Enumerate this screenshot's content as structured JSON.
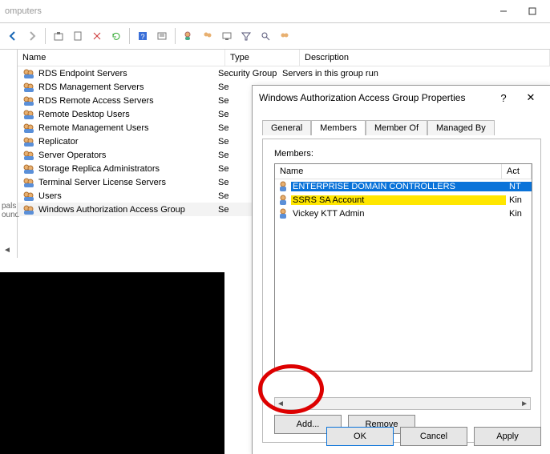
{
  "main_window": {
    "title_fragment": "omputers",
    "toolbar_hints": [
      "back",
      "forward",
      "up",
      "paste",
      "tree",
      "refresh",
      "help",
      "properties",
      "add-user-icon",
      "add-group-icon",
      "find-icon",
      "filter-icon",
      "actions-icon",
      "group-icon"
    ]
  },
  "left_strip": {
    "label": "pals",
    "sublabel": "ound"
  },
  "columns": {
    "name": "Name",
    "type": "Type",
    "desc": "Description"
  },
  "rows": [
    {
      "name": "RDS Endpoint Servers",
      "type": "Security Group",
      "desc": "Servers in this group run"
    },
    {
      "name": "RDS Management Servers",
      "type": "Se"
    },
    {
      "name": "RDS Remote Access Servers",
      "type": "Se"
    },
    {
      "name": "Remote Desktop Users",
      "type": "Se"
    },
    {
      "name": "Remote Management Users",
      "type": "Se"
    },
    {
      "name": "Replicator",
      "type": "Se"
    },
    {
      "name": "Server Operators",
      "type": "Se"
    },
    {
      "name": "Storage Replica Administrators",
      "type": "Se"
    },
    {
      "name": "Terminal Server License Servers",
      "type": "Se"
    },
    {
      "name": "Users",
      "type": "Se"
    },
    {
      "name": "Windows Authorization Access Group",
      "type": "Se",
      "selected": true
    }
  ],
  "dialog": {
    "title": "Windows Authorization Access Group Properties",
    "help": "?",
    "close": "✕",
    "tabs": [
      "General",
      "Members",
      "Member Of",
      "Managed By"
    ],
    "active_tab": "Members",
    "members_label": "Members:",
    "col_name": "Name",
    "col_act": "Act",
    "members": [
      {
        "name": "ENTERPRISE DOMAIN CONTROLLERS",
        "act": "NT",
        "selected": true
      },
      {
        "name": "SSRS SA Account",
        "act": "Kin",
        "highlight": true
      },
      {
        "name": "Vickey KTT Admin",
        "act": "Kin"
      }
    ],
    "add": "Add...",
    "remove": "Remove",
    "ok": "OK",
    "cancel": "Cancel",
    "apply": "Apply"
  }
}
